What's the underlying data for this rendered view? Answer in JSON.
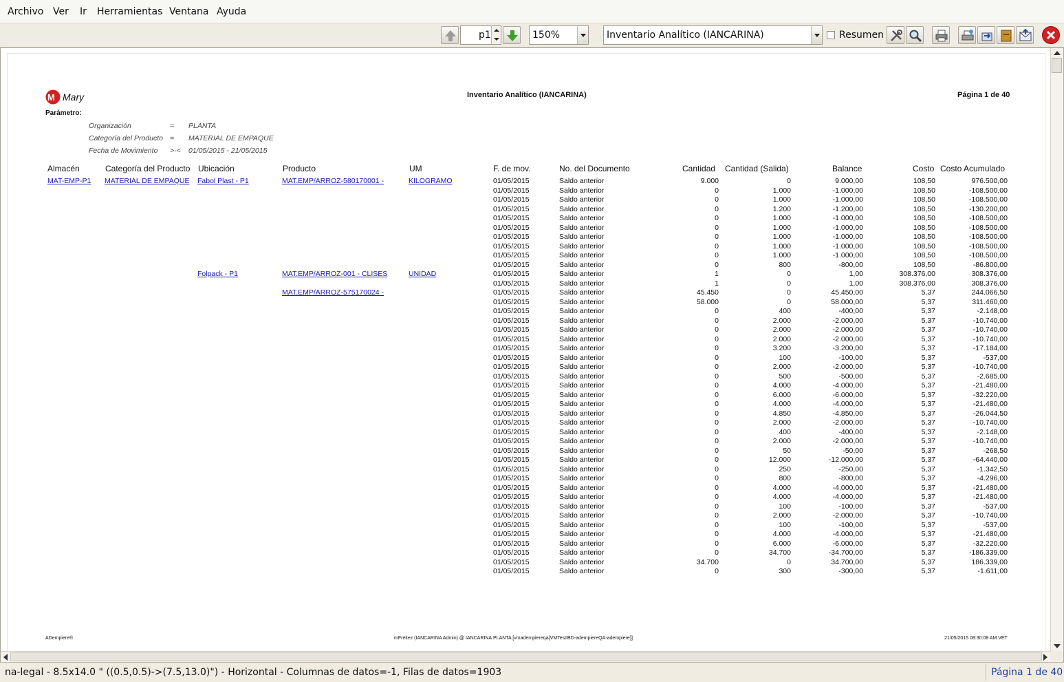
{
  "menu": [
    "Archivo",
    "Ver",
    "Ir",
    "Herramientas",
    "Ventana",
    "Ayuda"
  ],
  "toolbar": {
    "page_value": "p1",
    "zoom_value": "150%",
    "report_value": "Inventario Analítico (IANCARINA)",
    "summary_label": "Resumen"
  },
  "report": {
    "logo_text": "Mary",
    "title": "Inventario Analítico (IANCARINA)",
    "page_label": "Página 1 de 40",
    "param_heading": "Parámetro:",
    "params": [
      {
        "name": "Organización",
        "op": "=",
        "value": "PLANTA"
      },
      {
        "name": "Categoría del Producto",
        "op": "=",
        "value": "MATERIAL DE EMPAQUE"
      },
      {
        "name": "Fecha de Movimiento",
        "op": ">-<",
        "value": "01/05/2015 - 21/05/2015"
      }
    ],
    "headers": [
      "Almacén",
      "Categoría del Producto",
      "Ubicación",
      "Producto",
      "UM",
      "F. de mov.",
      "No. del Documento",
      "Cantidad",
      "Cantidad (Salida)",
      "Balance",
      "Costo",
      "Costo Acumulado"
    ],
    "group_links": [
      {
        "row": 0,
        "almacen": "MAT-EMP-P1",
        "categoria": "MATERIAL DE EMPAQUE",
        "ubicacion": "Fabol Plast - P1",
        "producto": "MAT.EMP/ARROZ-580170001 -",
        "um": "KILOGRAMO"
      },
      {
        "row": 10,
        "almacen": "",
        "categoria": "",
        "ubicacion": "Folpack - P1",
        "producto": "MAT.EMP/ARROZ-001 - CLISES",
        "um": "UNIDAD"
      },
      {
        "row": 12,
        "almacen": "",
        "categoria": "",
        "ubicacion": "",
        "producto": "MAT.EMP/ARROZ-575170024 -",
        "um": ""
      }
    ],
    "rows": [
      [
        "01/05/2015",
        "Saldo anterior",
        "9.000",
        "0",
        "9.000,00",
        "108,50",
        "976.500,00"
      ],
      [
        "01/05/2015",
        "Saldo anterior",
        "0",
        "1.000",
        "-1.000,00",
        "108,50",
        "-108.500,00"
      ],
      [
        "01/05/2015",
        "Saldo anterior",
        "0",
        "1.000",
        "-1.000,00",
        "108,50",
        "-108.500,00"
      ],
      [
        "01/05/2015",
        "Saldo anterior",
        "0",
        "1.200",
        "-1.200,00",
        "108,50",
        "-130.200,00"
      ],
      [
        "01/05/2015",
        "Saldo anterior",
        "0",
        "1.000",
        "-1.000,00",
        "108,50",
        "-108.500,00"
      ],
      [
        "01/05/2015",
        "Saldo anterior",
        "0",
        "1.000",
        "-1.000,00",
        "108,50",
        "-108.500,00"
      ],
      [
        "01/05/2015",
        "Saldo anterior",
        "0",
        "1.000",
        "-1.000,00",
        "108,50",
        "-108.500,00"
      ],
      [
        "01/05/2015",
        "Saldo anterior",
        "0",
        "1.000",
        "-1.000,00",
        "108,50",
        "-108.500,00"
      ],
      [
        "01/05/2015",
        "Saldo anterior",
        "0",
        "1.000",
        "-1.000,00",
        "108,50",
        "-108.500,00"
      ],
      [
        "01/05/2015",
        "Saldo anterior",
        "0",
        "800",
        "-800,00",
        "108,50",
        "-86.800,00"
      ],
      [
        "01/05/2015",
        "Saldo anterior",
        "1",
        "0",
        "1,00",
        "308.376,00",
        "308.376,00"
      ],
      [
        "01/05/2015",
        "Saldo anterior",
        "1",
        "0",
        "1,00",
        "308.376,00",
        "308.376,00"
      ],
      [
        "01/05/2015",
        "Saldo anterior",
        "45.450",
        "0",
        "45.450,00",
        "5,37",
        "244.066,50"
      ],
      [
        "01/05/2015",
        "Saldo anterior",
        "58.000",
        "0",
        "58.000,00",
        "5,37",
        "311.460,00"
      ],
      [
        "01/05/2015",
        "Saldo anterior",
        "0",
        "400",
        "-400,00",
        "5,37",
        "-2.148,00"
      ],
      [
        "01/05/2015",
        "Saldo anterior",
        "0",
        "2.000",
        "-2.000,00",
        "5,37",
        "-10.740,00"
      ],
      [
        "01/05/2015",
        "Saldo anterior",
        "0",
        "2.000",
        "-2.000,00",
        "5,37",
        "-10.740,00"
      ],
      [
        "01/05/2015",
        "Saldo anterior",
        "0",
        "2.000",
        "-2.000,00",
        "5,37",
        "-10.740,00"
      ],
      [
        "01/05/2015",
        "Saldo anterior",
        "0",
        "3.200",
        "-3.200,00",
        "5,37",
        "-17.184,00"
      ],
      [
        "01/05/2015",
        "Saldo anterior",
        "0",
        "100",
        "-100,00",
        "5,37",
        "-537,00"
      ],
      [
        "01/05/2015",
        "Saldo anterior",
        "0",
        "2.000",
        "-2.000,00",
        "5,37",
        "-10.740,00"
      ],
      [
        "01/05/2015",
        "Saldo anterior",
        "0",
        "500",
        "-500,00",
        "5,37",
        "-2.685,00"
      ],
      [
        "01/05/2015",
        "Saldo anterior",
        "0",
        "4.000",
        "-4.000,00",
        "5,37",
        "-21.480,00"
      ],
      [
        "01/05/2015",
        "Saldo anterior",
        "0",
        "6.000",
        "-6.000,00",
        "5,37",
        "-32.220,00"
      ],
      [
        "01/05/2015",
        "Saldo anterior",
        "0",
        "4.000",
        "-4.000,00",
        "5,37",
        "-21.480,00"
      ],
      [
        "01/05/2015",
        "Saldo anterior",
        "0",
        "4.850",
        "-4.850,00",
        "5,37",
        "-26.044,50"
      ],
      [
        "01/05/2015",
        "Saldo anterior",
        "0",
        "2.000",
        "-2.000,00",
        "5,37",
        "-10.740,00"
      ],
      [
        "01/05/2015",
        "Saldo anterior",
        "0",
        "400",
        "-400,00",
        "5,37",
        "-2.148,00"
      ],
      [
        "01/05/2015",
        "Saldo anterior",
        "0",
        "2.000",
        "-2.000,00",
        "5,37",
        "-10.740,00"
      ],
      [
        "01/05/2015",
        "Saldo anterior",
        "0",
        "50",
        "-50,00",
        "5,37",
        "-268,50"
      ],
      [
        "01/05/2015",
        "Saldo anterior",
        "0",
        "12.000",
        "-12.000,00",
        "5,37",
        "-64.440,00"
      ],
      [
        "01/05/2015",
        "Saldo anterior",
        "0",
        "250",
        "-250,00",
        "5,37",
        "-1.342,50"
      ],
      [
        "01/05/2015",
        "Saldo anterior",
        "0",
        "800",
        "-800,00",
        "5,37",
        "-4.296,00"
      ],
      [
        "01/05/2015",
        "Saldo anterior",
        "0",
        "4.000",
        "-4.000,00",
        "5,37",
        "-21.480,00"
      ],
      [
        "01/05/2015",
        "Saldo anterior",
        "0",
        "4.000",
        "-4.000,00",
        "5,37",
        "-21.480,00"
      ],
      [
        "01/05/2015",
        "Saldo anterior",
        "0",
        "100",
        "-100,00",
        "5,37",
        "-537,00"
      ],
      [
        "01/05/2015",
        "Saldo anterior",
        "0",
        "2.000",
        "-2.000,00",
        "5,37",
        "-10.740,00"
      ],
      [
        "01/05/2015",
        "Saldo anterior",
        "0",
        "100",
        "-100,00",
        "5,37",
        "-537,00"
      ],
      [
        "01/05/2015",
        "Saldo anterior",
        "0",
        "4.000",
        "-4.000,00",
        "5,37",
        "-21.480,00"
      ],
      [
        "01/05/2015",
        "Saldo anterior",
        "0",
        "6.000",
        "-6.000,00",
        "5,37",
        "-32.220,00"
      ],
      [
        "01/05/2015",
        "Saldo anterior",
        "0",
        "34.700",
        "-34.700,00",
        "5,37",
        "-186.339,00"
      ],
      [
        "01/05/2015",
        "Saldo anterior",
        "34.700",
        "0",
        "34.700,00",
        "5,37",
        "186.339,00"
      ],
      [
        "01/05/2015",
        "Saldo anterior",
        "0",
        "300",
        "-300,00",
        "5,37",
        "-1.611,00"
      ]
    ],
    "footer_left": "ADempiere®",
    "footer_center": "mFreitez (IANCARINA Admin) @ IANCARINA.PLANTA [vmadempiereqa{VMTestIBD-adempiereQA-adempiere}]",
    "footer_right": "21/05/2015 08:30:08 AM VET"
  },
  "status": {
    "left": "na-legal - 8.5x14.0 \" ((0.5,0.5)->(7.5,13.0)\") - Horizontal - Columnas de datos=-1, Filas de datos=1903",
    "right": "Página 1 de 40"
  },
  "colors": {
    "link": "#1a1ab0",
    "close_button": "#d42020",
    "nav_up": "#9a9a9a",
    "nav_down": "#3aa02a"
  }
}
